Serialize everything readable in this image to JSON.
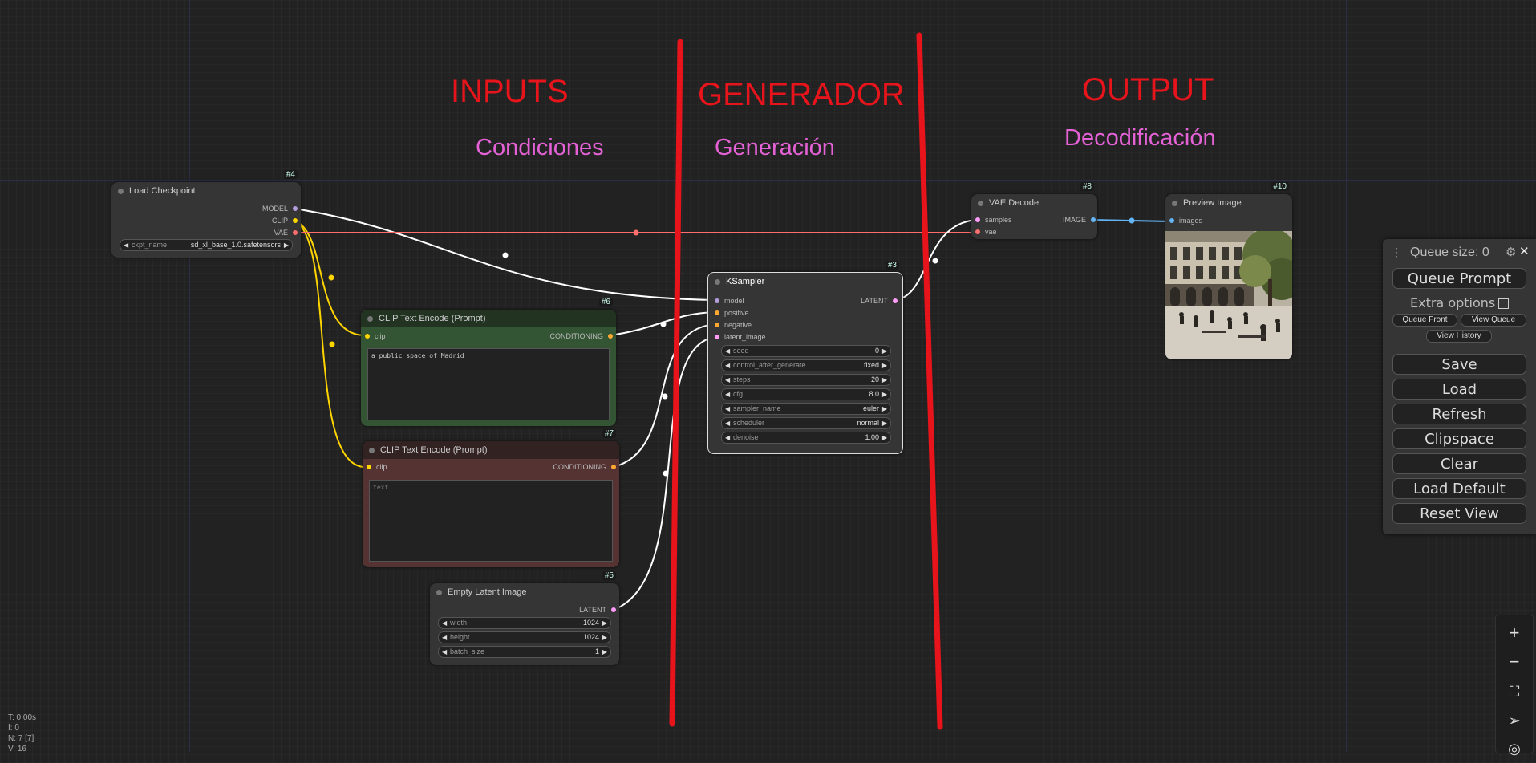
{
  "annotations": {
    "inputs": "INPUTS",
    "generador": "GENERADOR",
    "output": "OUTPUT",
    "condiciones": "Condiciones",
    "generacion": "Generación",
    "decodificacion": "Decodificación"
  },
  "nodes": {
    "load_checkpoint": {
      "id": "#4",
      "title": "Load Checkpoint",
      "outputs": [
        "MODEL",
        "CLIP",
        "VAE"
      ],
      "widget": {
        "label": "ckpt_name",
        "value": "sd_xl_base_1.0.safetensors"
      }
    },
    "clip_pos": {
      "id": "#6",
      "title": "CLIP Text Encode (Prompt)",
      "input": "clip",
      "output": "CONDITIONING",
      "text": "a public space of Madrid"
    },
    "clip_neg": {
      "id": "#7",
      "title": "CLIP Text Encode (Prompt)",
      "input": "clip",
      "output": "CONDITIONING",
      "placeholder": "text"
    },
    "empty_latent": {
      "id": "#5",
      "title": "Empty Latent Image",
      "output": "LATENT",
      "widgets": [
        {
          "label": "width",
          "value": "1024"
        },
        {
          "label": "height",
          "value": "1024"
        },
        {
          "label": "batch_size",
          "value": "1"
        }
      ]
    },
    "ksampler": {
      "id": "#3",
      "title": "KSampler",
      "inputs": [
        "model",
        "positive",
        "negative",
        "latent_image"
      ],
      "output": "LATENT",
      "widgets": [
        {
          "label": "seed",
          "value": "0"
        },
        {
          "label": "control_after_generate",
          "value": "fixed"
        },
        {
          "label": "steps",
          "value": "20"
        },
        {
          "label": "cfg",
          "value": "8.0"
        },
        {
          "label": "sampler_name",
          "value": "euler"
        },
        {
          "label": "scheduler",
          "value": "normal"
        },
        {
          "label": "denoise",
          "value": "1.00"
        }
      ]
    },
    "vae_decode": {
      "id": "#8",
      "title": "VAE Decode",
      "inputs": [
        "samples",
        "vae"
      ],
      "output": "IMAGE"
    },
    "preview": {
      "id": "#10",
      "title": "Preview Image",
      "input": "images"
    }
  },
  "panel": {
    "queue_size": "Queue size: 0",
    "queue_prompt": "Queue Prompt",
    "extra_options": "Extra options",
    "queue_front": "Queue Front",
    "view_queue": "View Queue",
    "view_history": "View History",
    "buttons": [
      "Save",
      "Load",
      "Refresh",
      "Clipspace",
      "Clear",
      "Load Default",
      "Reset View"
    ]
  },
  "stats": [
    "T: 0.00s",
    "I: 0",
    "N: 7 [7]",
    "V: 16"
  ],
  "colors": {
    "model": "#b39ddb",
    "clip": "#ffd500",
    "vae": "#ff6e6e",
    "conditioning": "#ffa931",
    "latent": "#ff9cf9",
    "image": "#64b5f6",
    "annotation_red": "#e8141c",
    "annotation_pink": "#e461d6"
  }
}
